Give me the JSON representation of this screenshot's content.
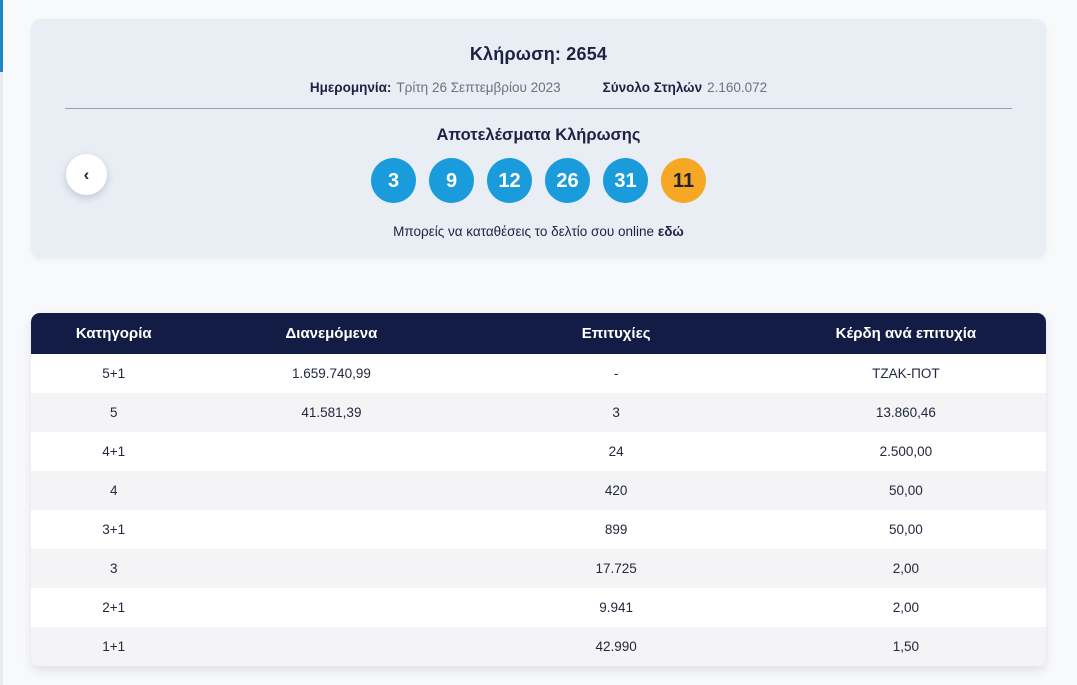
{
  "colors": {
    "accent_blue": "#1a9cdc",
    "accent_orange": "#f6a724",
    "navy": "#131c45",
    "card_bg": "#e9edf4",
    "row_alt_bg": "#f4f4f6",
    "page_bg": "#f8f9fb"
  },
  "icons": {
    "chevron_left": "‹"
  },
  "draw_card": {
    "title": "Κλήρωση: 2654",
    "date_label": "Ημερομηνία:",
    "date_value": "Τρίτη 26 Σεπτεμβρίου 2023",
    "columns_label": "Σύνολο Στηλών",
    "columns_value": "2.160.072",
    "results_title": "Αποτελέσματα Κλήρωσης",
    "numbers": [
      "3",
      "9",
      "12",
      "26",
      "31"
    ],
    "tzoker_number": "11",
    "online_text": "Μπορείς να καταθέσεις το δελτίο σου online",
    "online_link_label": "εδώ"
  },
  "table": {
    "headers": [
      "Κατηγορία",
      "Διανεμόμενα",
      "Επιτυχίες",
      "Κέρδη ανά επιτυχία"
    ],
    "rows": [
      [
        "5+1",
        "1.659.740,99",
        "-",
        "ΤΖΑΚ-ΠΟΤ"
      ],
      [
        "5",
        "41.581,39",
        "3",
        "13.860,46"
      ],
      [
        "4+1",
        "",
        "24",
        "2.500,00"
      ],
      [
        "4",
        "",
        "420",
        "50,00"
      ],
      [
        "3+1",
        "",
        "899",
        "50,00"
      ],
      [
        "3",
        "",
        "17.725",
        "2,00"
      ],
      [
        "2+1",
        "",
        "9.941",
        "2,00"
      ],
      [
        "1+1",
        "",
        "42.990",
        "1,50"
      ]
    ]
  }
}
